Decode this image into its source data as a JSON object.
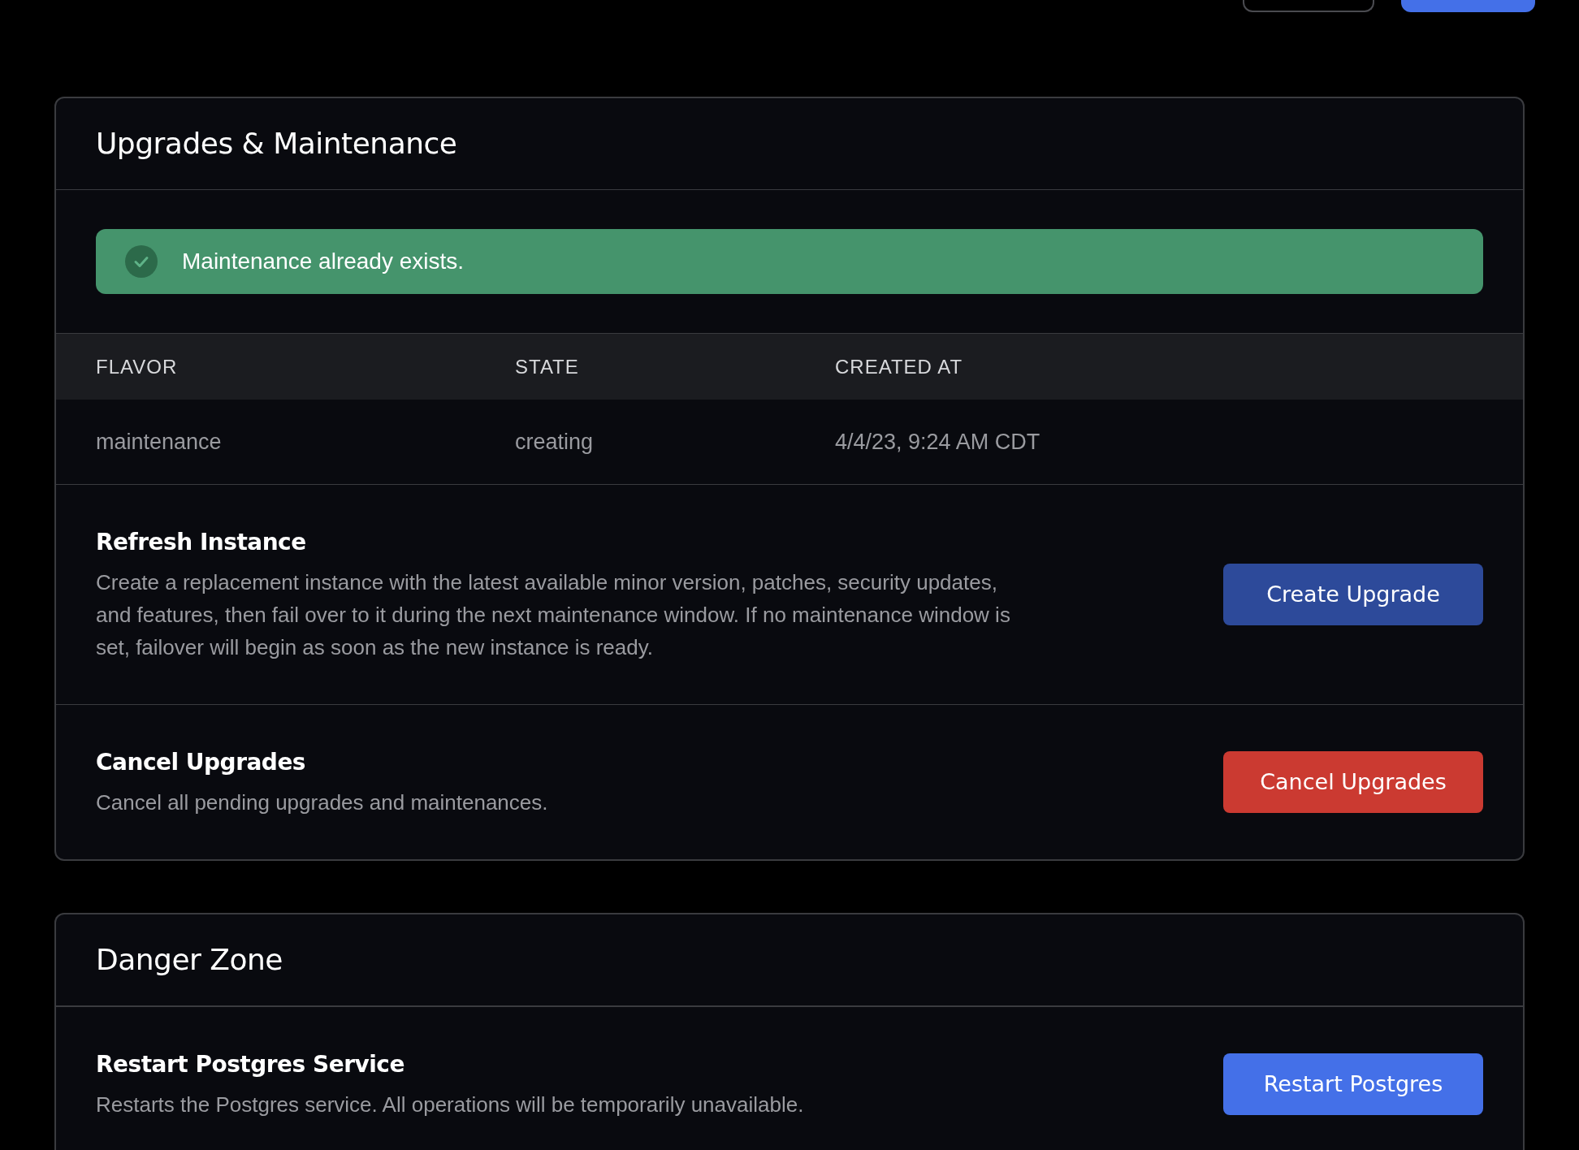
{
  "top_buttons": [
    {
      "kind": "outline"
    },
    {
      "kind": "primary"
    }
  ],
  "maintenance": {
    "title": "Upgrades & Maintenance",
    "alert": {
      "kind": "success",
      "message": "Maintenance already exists."
    },
    "table": {
      "columns": [
        "FLAVOR",
        "STATE",
        "CREATED AT"
      ],
      "rows": [
        [
          "maintenance",
          "creating",
          "4/4/23, 9:24 AM CDT"
        ]
      ]
    },
    "sections": [
      {
        "title": "Refresh Instance",
        "description": "Create a replacement instance with the latest available minor version, patches, security updates, and features, then fail over to it during the next maintenance window. If no maintenance window is set, failover will begin as soon as the new instance is ready.",
        "button": {
          "label": "Create Upgrade",
          "kind": "primary",
          "disabled": true
        }
      },
      {
        "title": "Cancel Upgrades",
        "description": "Cancel all pending upgrades and maintenances.",
        "button": {
          "label": "Cancel Upgrades",
          "kind": "danger",
          "disabled": false
        }
      }
    ]
  },
  "danger_zone": {
    "title": "Danger Zone",
    "sections": [
      {
        "title": "Restart Postgres Service",
        "description": "Restarts the Postgres service. All operations will be temporarily unavailable.",
        "button": {
          "label": "Restart Postgres",
          "kind": "primary",
          "disabled": false
        }
      }
    ]
  }
}
